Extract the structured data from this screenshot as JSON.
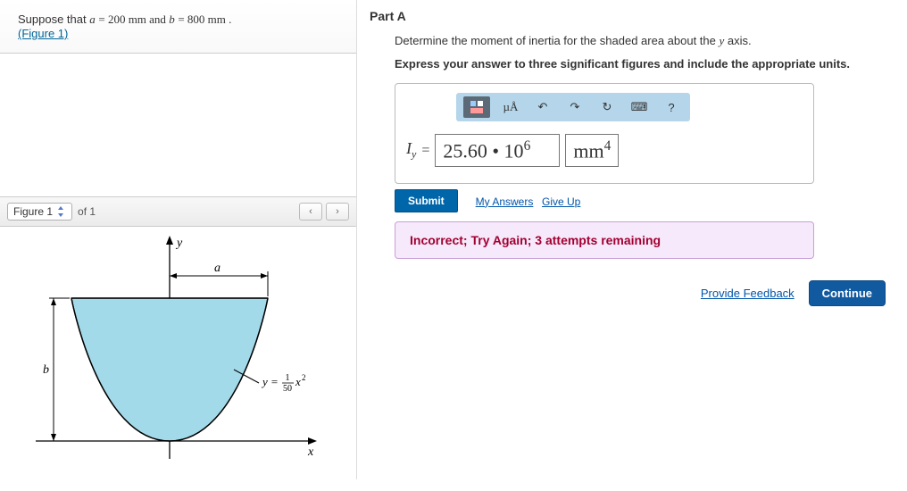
{
  "prompt": {
    "prefix": "Suppose that ",
    "a_var": "a",
    "a_eq": " = 200  mm and ",
    "b_var": "b",
    "b_eq": " = 800  mm .",
    "figure_link": "(Figure 1)"
  },
  "figure_nav": {
    "label": "Figure 1",
    "of": "of 1"
  },
  "figure": {
    "y_label": "y",
    "x_label": "x",
    "a_label": "a",
    "b_label": "b",
    "curve_eq_prefix": "y = ",
    "curve_eq_num": "1",
    "curve_eq_den": "50",
    "curve_eq_suffix": "x",
    "curve_eq_power": "2"
  },
  "part": {
    "label": "Part A",
    "question_prefix": "Determine the moment of inertia for the shaded area about the ",
    "question_axis": "y",
    "question_suffix": " axis.",
    "hint": "Express your answer to three significant figures and include the appropriate units."
  },
  "toolbar": {
    "btn_template": "template",
    "btn_units": "µÅ",
    "btn_undo": "↶",
    "btn_redo": "↷",
    "btn_reset": "↻",
    "btn_keyboard": "⌨",
    "btn_help": "?"
  },
  "answer": {
    "symbol": "I",
    "subscript": "y",
    "equals": "=",
    "value_base": "25.60 • 10",
    "value_exp": "6",
    "unit_base": "mm",
    "unit_exp": "4"
  },
  "actions": {
    "submit": "Submit",
    "my_answers": "My Answers",
    "give_up": "Give Up"
  },
  "feedback": "Incorrect; Try Again; 3 attempts remaining",
  "footer": {
    "provide_feedback": "Provide Feedback",
    "continue": "Continue"
  },
  "chart_data": {
    "type": "area",
    "title": "Parabolic shaded region",
    "curve": "y = (1/50) * x^2",
    "a_mm": 200,
    "b_mm": 800,
    "x_range": [
      -200,
      200
    ],
    "y_range": [
      0,
      800
    ],
    "xlabel": "x",
    "ylabel": "y",
    "annotations": [
      "a (half-width at top)",
      "b (height)"
    ]
  }
}
